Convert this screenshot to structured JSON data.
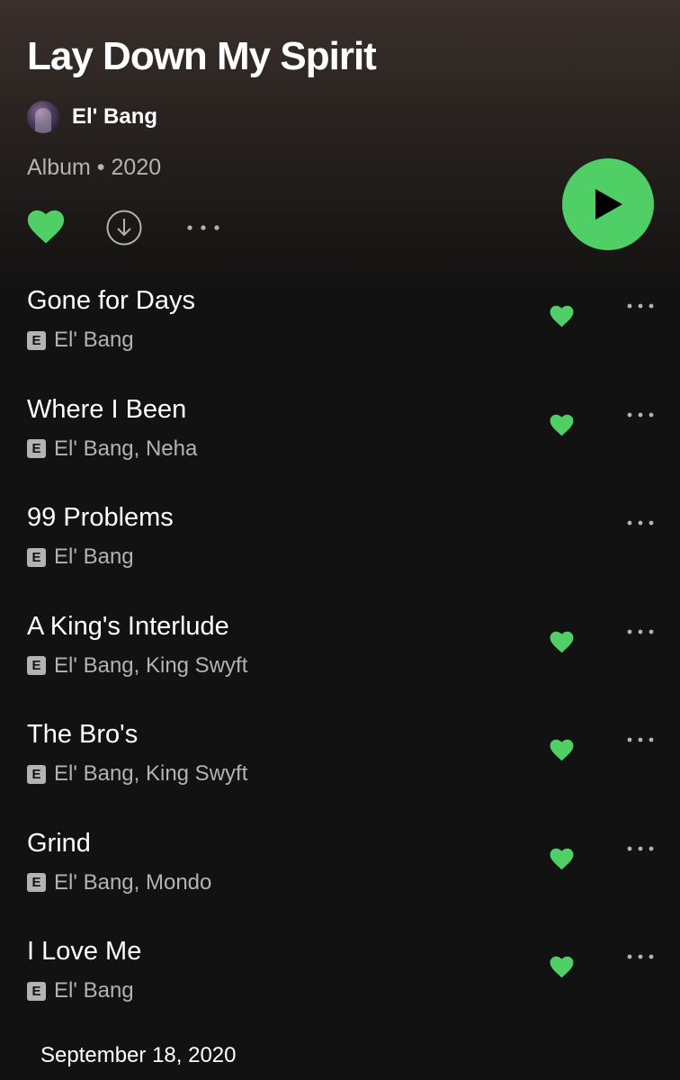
{
  "album": {
    "title": "Lay Down My Spirit",
    "artist": "El' Bang",
    "meta": "Album • 2020",
    "release_date": "September 18, 2020"
  },
  "colors": {
    "accent": "#4fcf66",
    "text_secondary": "#b3b3b3",
    "background": "#121212"
  },
  "icons": {
    "like": "heart-icon",
    "download": "download-icon",
    "more": "more-icon",
    "play": "play-icon",
    "explicit": "explicit-icon"
  },
  "tracks": [
    {
      "title": "Gone for Days",
      "artists": "El' Bang",
      "explicit_label": "E",
      "liked": true
    },
    {
      "title": "Where I Been",
      "artists": "El' Bang, Neha",
      "explicit_label": "E",
      "liked": true
    },
    {
      "title": "99 Problems",
      "artists": "El' Bang",
      "explicit_label": "E",
      "liked": false
    },
    {
      "title": "A King's Interlude",
      "artists": "El' Bang, King Swyft",
      "explicit_label": "E",
      "liked": true
    },
    {
      "title": "The Bro's",
      "artists": "El' Bang, King Swyft",
      "explicit_label": "E",
      "liked": true
    },
    {
      "title": "Grind",
      "artists": "El' Bang, Mondo",
      "explicit_label": "E",
      "liked": true
    },
    {
      "title": "I Love Me",
      "artists": "El' Bang",
      "explicit_label": "E",
      "liked": true
    }
  ]
}
